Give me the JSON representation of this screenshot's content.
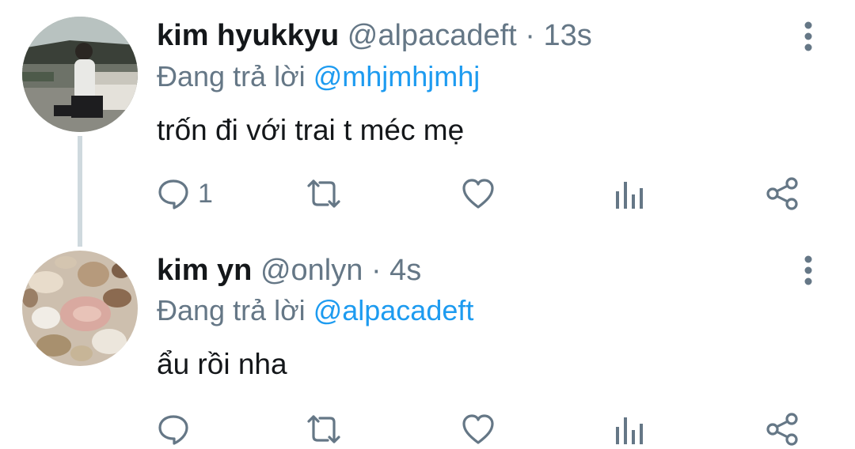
{
  "tweets": [
    {
      "author_name": "kim hyukkyu",
      "handle": "@alpacadeft",
      "separator": "·",
      "time": "13s",
      "reply_prefix": "Đang trả lời",
      "reply_mention": "@mhjmhjmhj",
      "text": "trốn đi với trai t méc mẹ",
      "reply_count": "1"
    },
    {
      "author_name": "kim yn",
      "handle": "@onlyn",
      "separator": "·",
      "time": "4s",
      "reply_prefix": "Đang trả lời",
      "reply_mention": "@alpacadeft",
      "text": "ẩu rồi nha",
      "reply_count": ""
    }
  ],
  "icons": {
    "reply": "reply-icon",
    "retweet": "retweet-icon",
    "like": "heart-icon",
    "views": "analytics-icon",
    "share": "share-icon",
    "more": "more-vertical-icon"
  },
  "colors": {
    "text": "#14171a",
    "secondary": "#657786",
    "mention": "#1d9bf0",
    "thread_line": "#cfd9de"
  }
}
